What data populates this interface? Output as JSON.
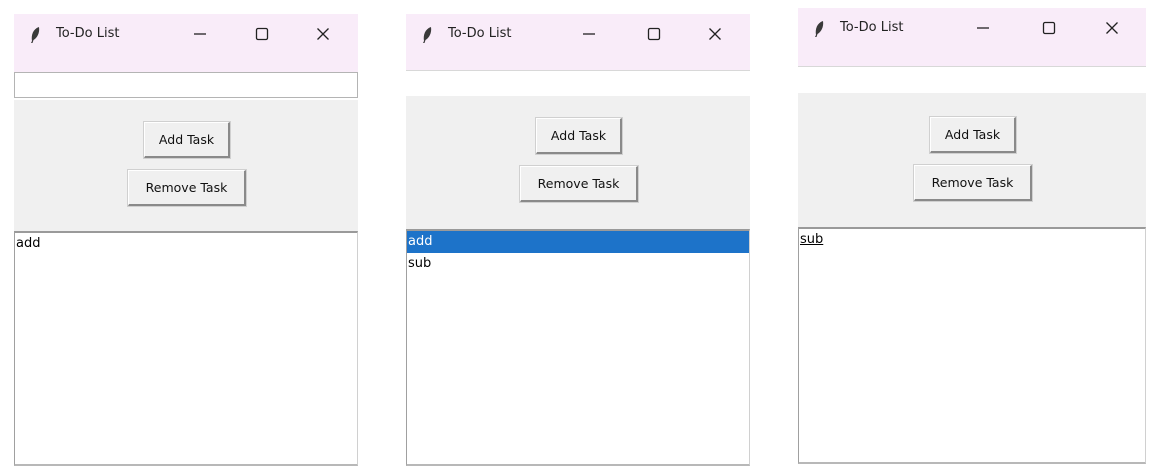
{
  "windows": [
    {
      "title": "To-Do List",
      "entry_value": "",
      "add_label": "Add Task",
      "remove_label": "Remove Task",
      "items": [
        {
          "text": "add",
          "selected": false,
          "active": false
        }
      ]
    },
    {
      "title": "To-Do List",
      "add_label": "Add Task",
      "remove_label": "Remove Task",
      "items": [
        {
          "text": "add",
          "selected": true,
          "active": false
        },
        {
          "text": "sub",
          "selected": false,
          "active": false
        }
      ]
    },
    {
      "title": "To-Do List",
      "add_label": "Add Task",
      "remove_label": "Remove Task",
      "items": [
        {
          "text": "sub",
          "selected": false,
          "active": true
        }
      ]
    }
  ],
  "icons": {
    "app": "feather-icon",
    "minimize": "minimize-icon",
    "maximize": "maximize-icon",
    "close": "close-icon"
  },
  "colors": {
    "titlebar": "#f9ecf9",
    "panel": "#f0f0f0",
    "selection": "#1d73c9"
  }
}
